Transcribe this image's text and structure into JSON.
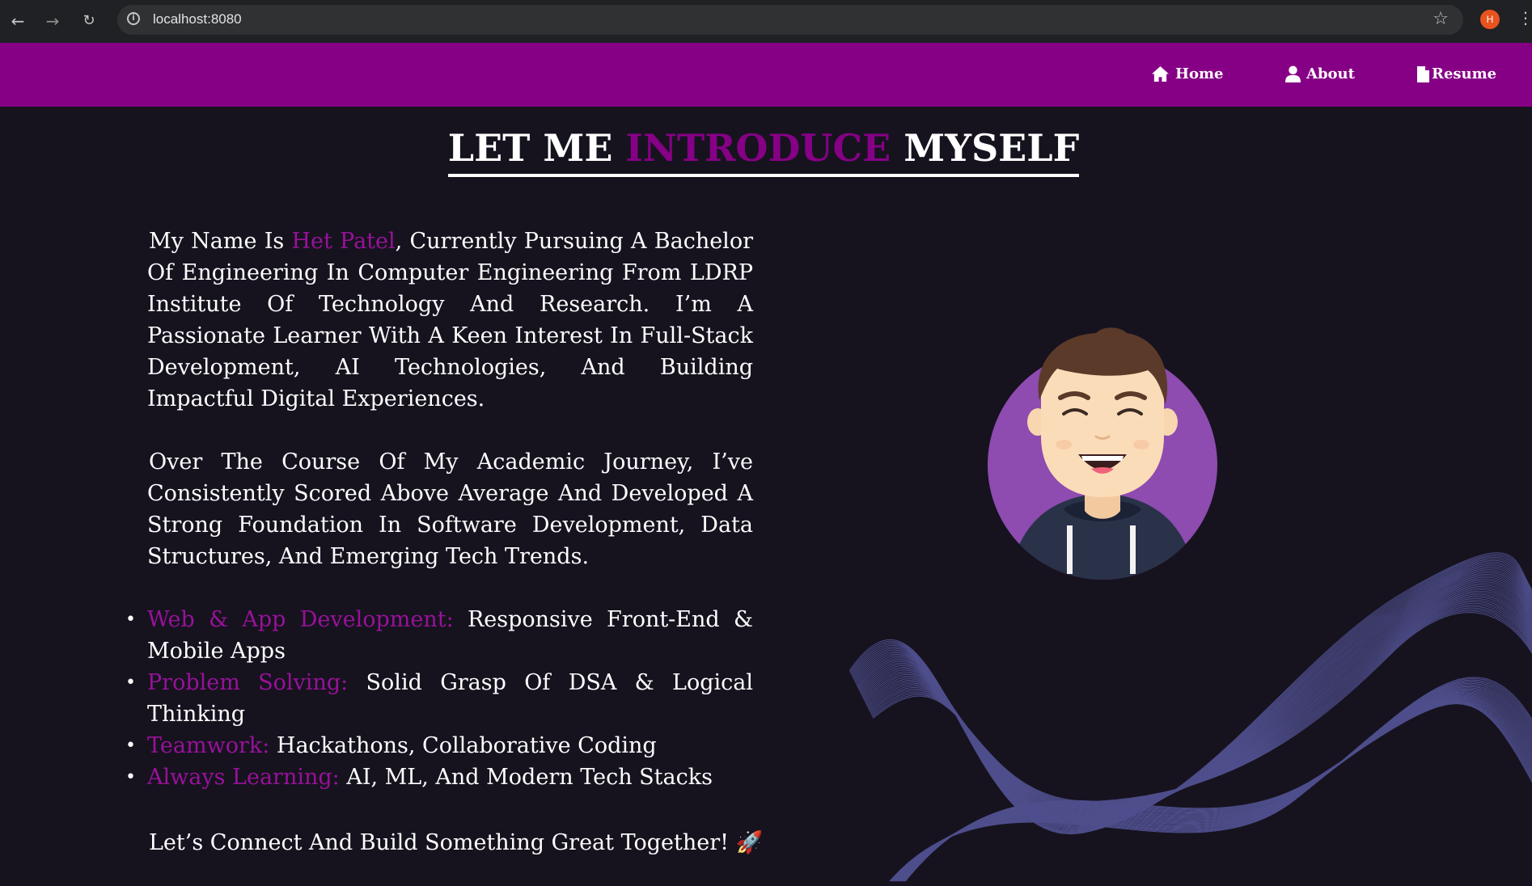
{
  "browser": {
    "url": "localhost:8080",
    "profile_initial": "H"
  },
  "navbar": {
    "items": [
      {
        "label": "Home",
        "icon": "home-icon"
      },
      {
        "label": "About",
        "icon": "user-icon"
      },
      {
        "label": "Resume",
        "icon": "document-icon"
      }
    ]
  },
  "heading": {
    "part1": "LET ME ",
    "highlight": "INTRODUCE",
    "part2": " MYSELF"
  },
  "intro": {
    "prefix": "My Name Is ",
    "name": "Het Patel",
    "rest": ", Currently Pursuing A Bachelor Of Engineering In Computer Engineering From LDRP Institute Of Technology And Research. I’m A Passionate Learner With A Keen Interest In Full-Stack Development, AI Technologies, And Building Impactful Digital Experiences."
  },
  "journey": "Over The Course Of My Academic Journey, I’ve Consistently Scored Above Average And Developed A Strong Foundation In Software Development, Data Structures, And Emerging Tech Trends.",
  "skills": [
    {
      "title": "Web & App Development:",
      "desc": " Responsive Front-End & Mobile Apps"
    },
    {
      "title": "Problem Solving:",
      "desc": " Solid Grasp Of DSA & Logical Thinking"
    },
    {
      "title": "Teamwork:",
      "desc": " Hackathons, Collaborative Coding"
    },
    {
      "title": "Always Learning:",
      "desc": " AI, ML, And Modern Tech Stacks"
    }
  ],
  "closing": "Let’s Connect And Build Something Great Together! 🚀",
  "colors": {
    "navbar": "#860085",
    "accent": "#99119a",
    "background": "#16131f"
  }
}
